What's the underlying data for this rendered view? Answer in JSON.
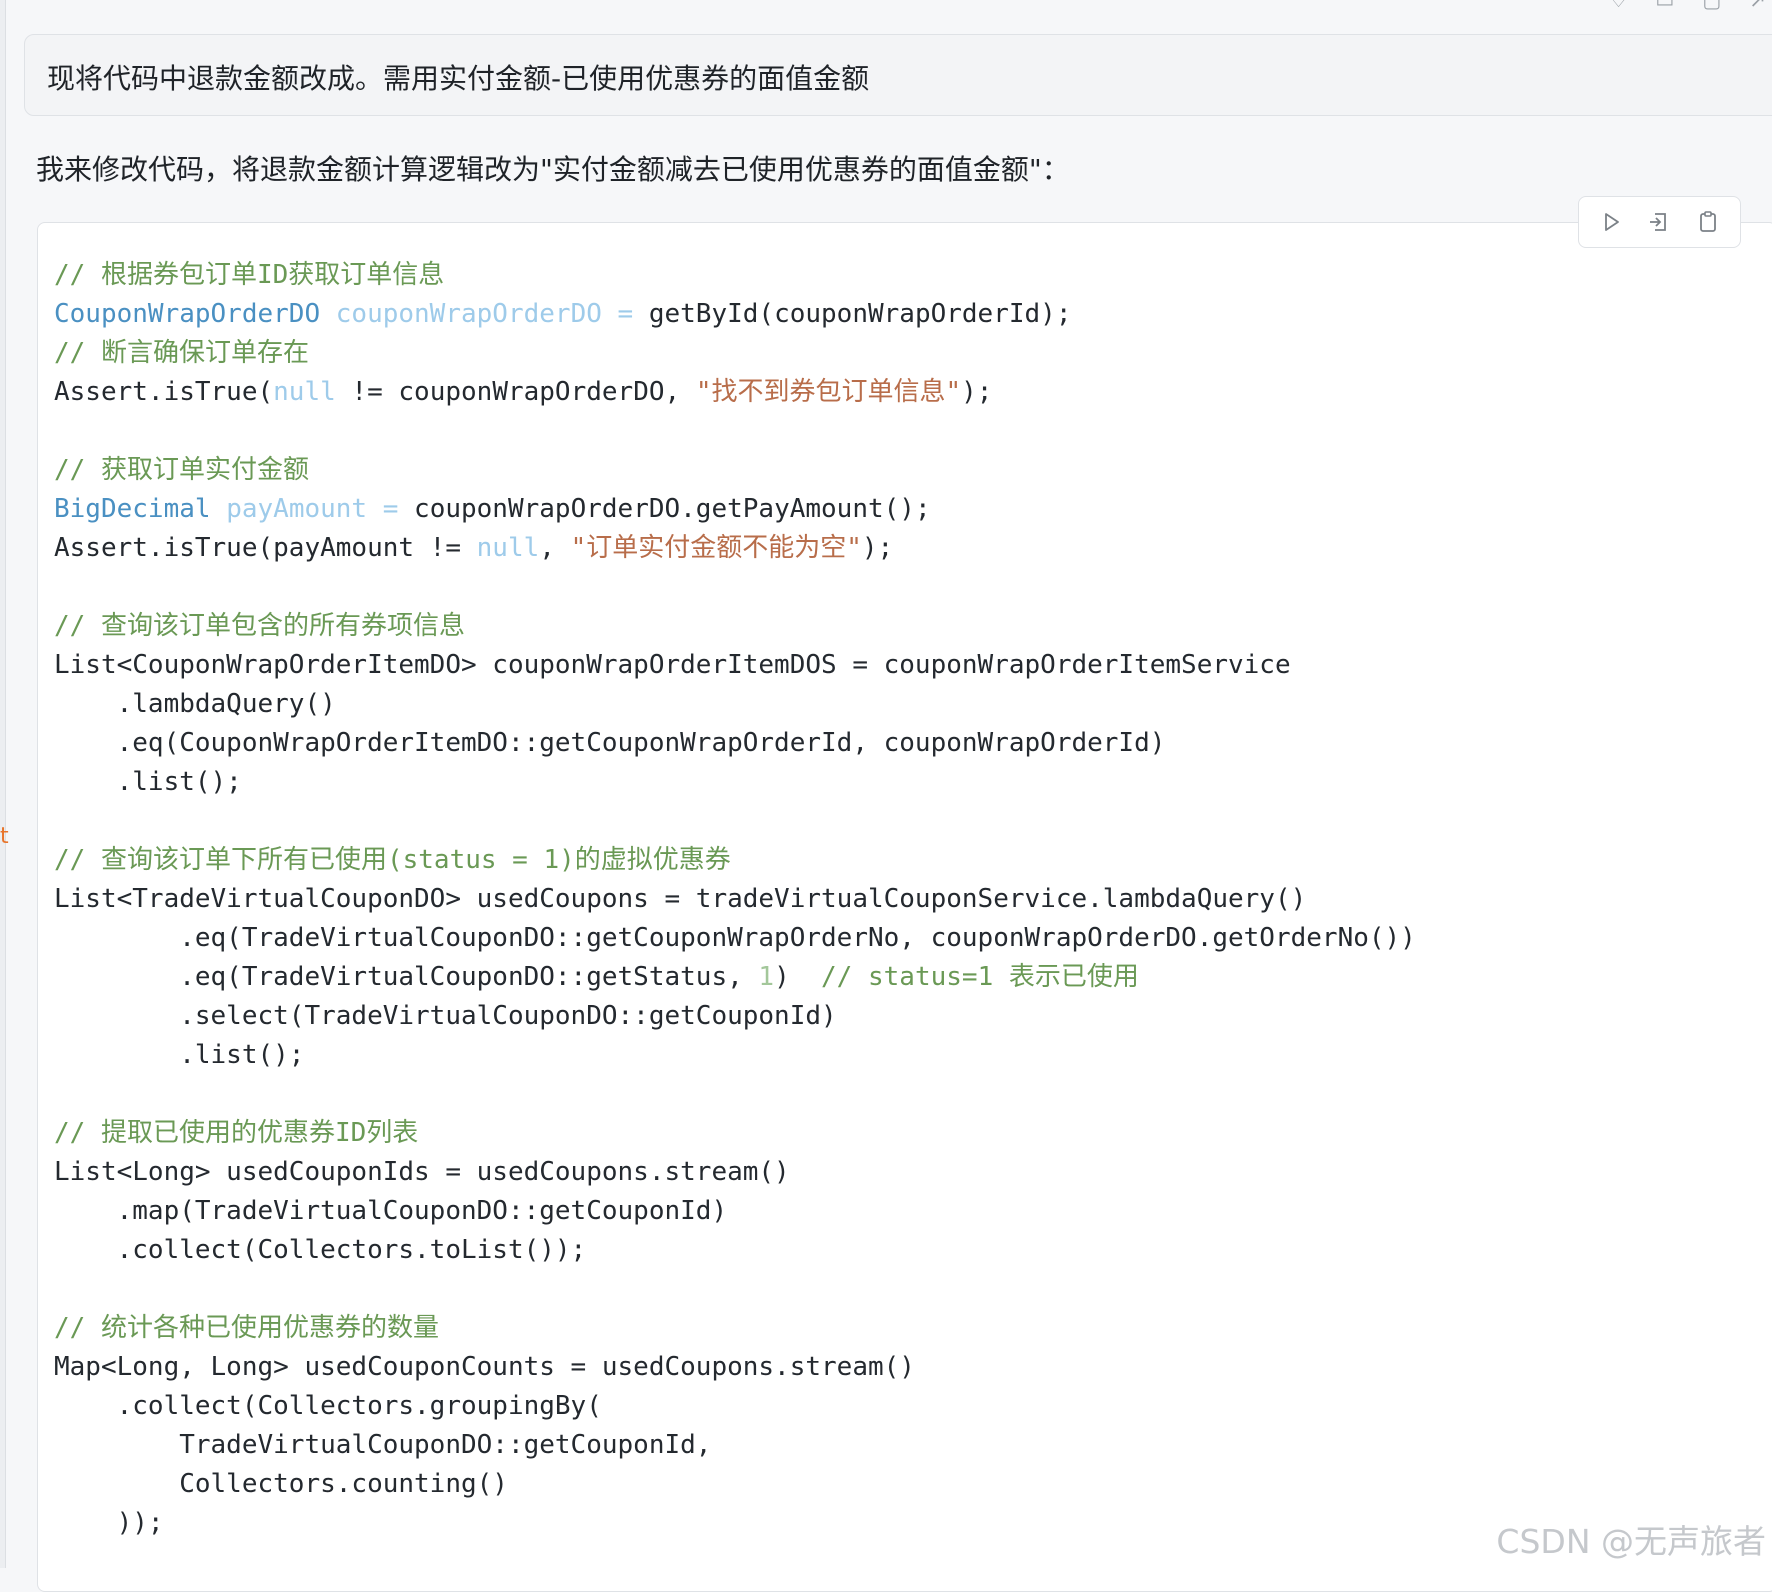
{
  "user_message": "现将代码中退款金额改成。需用实付金额-已使用优惠券的面值金额",
  "assistant_intro": "我来修改代码，将退款金额计算逻辑改为\"实付金额减去已使用优惠券的面值金额\"：",
  "left_marker": "t",
  "watermark": "CSDN @无声旅者",
  "toolbar": {
    "icons": [
      "run-icon",
      "insert-icon",
      "copy-icon"
    ]
  },
  "code": {
    "language": "java",
    "lines": [
      [
        {
          "k": "c",
          "t": "// 根据券包订单ID获取订单信息"
        }
      ],
      [
        {
          "k": "t",
          "t": "CouponWrapOrderDO"
        },
        {
          "k": "p",
          "t": " "
        },
        {
          "k": "v",
          "t": "couponWrapOrderDO ="
        },
        {
          "k": "p",
          "t": " getById(couponWrapOrderId);"
        }
      ],
      [
        {
          "k": "c",
          "t": "// 断言确保订单存在"
        }
      ],
      [
        {
          "k": "p",
          "t": "Assert.isTrue("
        },
        {
          "k": "v",
          "t": "null"
        },
        {
          "k": "p",
          "t": " != couponWrapOrderDO, "
        },
        {
          "k": "s",
          "t": "\"找不到券包订单信息\""
        },
        {
          "k": "p",
          "t": ");"
        }
      ],
      [],
      [
        {
          "k": "c",
          "t": "// 获取订单实付金额"
        }
      ],
      [
        {
          "k": "t",
          "t": "BigDecimal"
        },
        {
          "k": "p",
          "t": " "
        },
        {
          "k": "v",
          "t": "payAmount ="
        },
        {
          "k": "p",
          "t": " couponWrapOrderDO.getPayAmount();"
        }
      ],
      [
        {
          "k": "p",
          "t": "Assert.isTrue(payAmount != "
        },
        {
          "k": "v",
          "t": "null"
        },
        {
          "k": "p",
          "t": ", "
        },
        {
          "k": "s",
          "t": "\"订单实付金额不能为空\""
        },
        {
          "k": "p",
          "t": ");"
        }
      ],
      [],
      [
        {
          "k": "c",
          "t": "// 查询该订单包含的所有券项信息"
        }
      ],
      [
        {
          "k": "p",
          "t": "List<CouponWrapOrderItemDO> couponWrapOrderItemDOS = couponWrapOrderItemService"
        }
      ],
      [
        {
          "k": "p",
          "t": "    .lambdaQuery()"
        }
      ],
      [
        {
          "k": "p",
          "t": "    .eq(CouponWrapOrderItemDO::getCouponWrapOrderId, couponWrapOrderId)"
        }
      ],
      [
        {
          "k": "p",
          "t": "    .list();"
        }
      ],
      [],
      [
        {
          "k": "c",
          "t": "// 查询该订单下所有已使用(status = 1)的虚拟优惠券"
        }
      ],
      [
        {
          "k": "p",
          "t": "List<TradeVirtualCouponDO> usedCoupons = tradeVirtualCouponService.lambdaQuery()"
        }
      ],
      [
        {
          "k": "p",
          "t": "        .eq(TradeVirtualCouponDO::getCouponWrapOrderNo, couponWrapOrderDO.getOrderNo())"
        }
      ],
      [
        {
          "k": "p",
          "t": "        .eq(TradeVirtualCouponDO::getStatus, "
        },
        {
          "k": "n",
          "t": "1"
        },
        {
          "k": "p",
          "t": ")  "
        },
        {
          "k": "c",
          "t": "// status=1 表示已使用"
        }
      ],
      [
        {
          "k": "p",
          "t": "        .select(TradeVirtualCouponDO::getCouponId)"
        }
      ],
      [
        {
          "k": "p",
          "t": "        .list();"
        }
      ],
      [],
      [
        {
          "k": "c",
          "t": "// 提取已使用的优惠券ID列表"
        }
      ],
      [
        {
          "k": "p",
          "t": "List<Long> usedCouponIds = usedCoupons.stream()"
        }
      ],
      [
        {
          "k": "p",
          "t": "    .map(TradeVirtualCouponDO::getCouponId)"
        }
      ],
      [
        {
          "k": "p",
          "t": "    .collect(Collectors.toList());"
        }
      ],
      [],
      [
        {
          "k": "c",
          "t": "// 统计各种已使用优惠券的数量"
        }
      ],
      [
        {
          "k": "p",
          "t": "Map<Long, Long> usedCouponCounts = usedCoupons.stream()"
        }
      ],
      [
        {
          "k": "p",
          "t": "    .collect(Collectors.groupingBy("
        }
      ],
      [
        {
          "k": "p",
          "t": "        TradeVirtualCouponDO::getCouponId,"
        }
      ],
      [
        {
          "k": "p",
          "t": "        Collectors.counting()"
        }
      ],
      [
        {
          "k": "p",
          "t": "    ));"
        }
      ]
    ]
  }
}
